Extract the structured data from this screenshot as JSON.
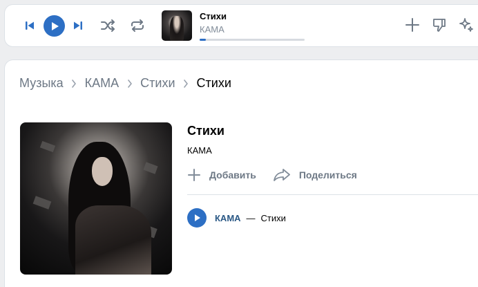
{
  "player": {
    "track_title": "Стихи",
    "track_artist": "КАМА",
    "progress_fraction": 0.06,
    "icons": [
      "previous-icon",
      "play-icon",
      "next-icon",
      "shuffle-icon",
      "repeat-icon",
      "plus-icon",
      "dislike-icon",
      "sparkle-icon"
    ]
  },
  "breadcrumb": {
    "items": [
      "Музыка",
      "КАМА",
      "Стихи",
      "Стихи"
    ]
  },
  "album": {
    "title": "Стихи",
    "artist": "КАМА",
    "add_label": "Добавить",
    "share_label": "Поделиться"
  },
  "tracklist": [
    {
      "artist": "КАМА",
      "dash": "—",
      "title": "Стихи"
    }
  ],
  "colors": {
    "accent": "#2d6fc4",
    "muted_text": "#6d7885",
    "link": "#2a5885",
    "background": "#edeef0"
  }
}
